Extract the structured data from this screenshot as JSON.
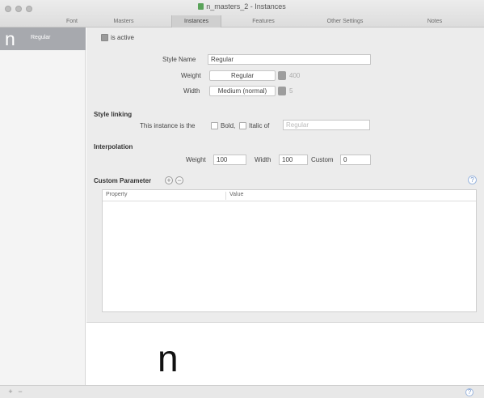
{
  "window": {
    "title": "n_masters_2 - Instances",
    "tabs": [
      "Font",
      "Masters",
      "Instances",
      "Features",
      "Other Settings",
      "Notes"
    ],
    "active_tab": "Instances"
  },
  "sidebar": {
    "items": [
      {
        "glyph": "n",
        "label": "Regular"
      }
    ]
  },
  "instance": {
    "is_active_label": "is active",
    "is_active": true,
    "style_name_label": "Style Name",
    "style_name": "Regular",
    "weight_label": "Weight",
    "weight": "Regular",
    "weight_class": "400",
    "width_label": "Width",
    "width": "Medium (normal)",
    "width_class": "5"
  },
  "style_linking": {
    "heading": "Style linking",
    "prefix": "This instance is the",
    "bold_label": "Bold,",
    "italic_label": "Italic of",
    "linked_placeholder": "Regular"
  },
  "interpolation": {
    "heading": "Interpolation",
    "weight_label": "Weight",
    "weight": "100",
    "width_label": "Width",
    "width": "100",
    "custom_label": "Custom",
    "custom": "0"
  },
  "custom_parameter": {
    "heading": "Custom Parameter",
    "add": "+",
    "remove": "−",
    "columns": [
      "Property",
      "Value"
    ]
  },
  "help": "?",
  "preview": {
    "glyph": "n"
  },
  "bottom_bar": {
    "add": "+",
    "remove": "−"
  },
  "colors": {
    "selection": "#a7a9ae",
    "panel": "#ececec",
    "help_accent": "#6f92c9"
  }
}
